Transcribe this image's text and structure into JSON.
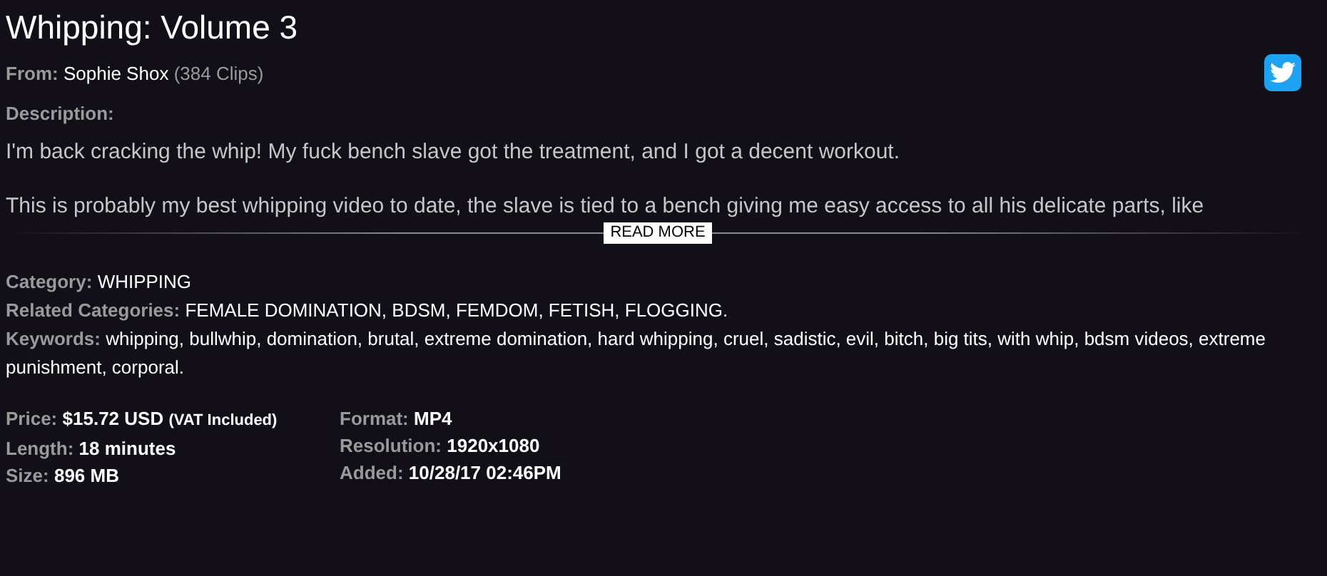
{
  "title": "Whipping: Volume 3",
  "from": {
    "label": "From:",
    "name": "Sophie Shox",
    "count": "(384 Clips)"
  },
  "share": {
    "kind": "twitter"
  },
  "description": {
    "label": "Description:",
    "paragraphs": [
      "I'm back cracking the whip! My fuck bench slave got the treatment, and I got a decent workout.",
      "This is probably my best whipping video to date, the slave is tied to a bench giving me easy access to all his delicate parts, like"
    ],
    "read_more": "READ MORE"
  },
  "meta": [
    {
      "label": "Category:",
      "value": "WHIPPING"
    },
    {
      "label": "Related Categories:",
      "value": "FEMALE DOMINATION, BDSM, FEMDOM, FETISH, FLOGGING."
    },
    {
      "label": "Keywords:",
      "value": "whipping, bullwhip, domination, brutal, extreme domination, hard whipping, cruel, sadistic, evil, bitch, big tits, with whip, bdsm videos, extreme punishment, corporal."
    }
  ],
  "details_left": [
    {
      "label": "Price:",
      "value": "$15.72 USD",
      "note": "(VAT Included)"
    },
    {
      "label": "Length:",
      "value": "18 minutes"
    },
    {
      "label": "Size:",
      "value": "896 MB"
    }
  ],
  "details_right": [
    {
      "label": "Format:",
      "value": "MP4"
    },
    {
      "label": "Resolution:",
      "value": "1920x1080"
    },
    {
      "label": "Added:",
      "value": "10/28/17 02:46PM"
    }
  ]
}
